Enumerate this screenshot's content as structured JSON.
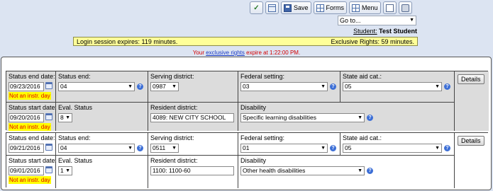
{
  "toolbar": {
    "save_label": "Save",
    "forms_label": "Forms",
    "menu_label": "Menu"
  },
  "goto": {
    "value": "Go to..."
  },
  "student": {
    "link_label": "Student:",
    "name": "Test Student"
  },
  "session": {
    "expires": "Login session expires: 119 minutes.",
    "exclusive": "Exclusive Rights: 59 minutes."
  },
  "rights": {
    "prefix": "Your ",
    "link": "exclusive rights",
    "suffix": " expire at 1:22:00 PM."
  },
  "records": [
    {
      "end_label": "Status end date:",
      "end_date": "09/23/2016",
      "end_warning": "Not an instr. day",
      "status_end_label": "Status end:",
      "status_end": "04",
      "serving_label": "Serving district:",
      "serving": "0987",
      "federal_label": "Federal setting:",
      "federal": "03",
      "stateaid_label": "State aid cat.:",
      "stateaid": "05",
      "details_label": "Details",
      "start_label": "Status start date:",
      "start_date": "09/20/2016",
      "start_warning": "Not an instr. day",
      "eval_label": "Eval. Status",
      "eval": "8",
      "resident_label": "Resident district:",
      "resident": "4089: NEW CITY SCHOOL",
      "disability_label": "Disability",
      "disability": "Specific learning disabilities"
    },
    {
      "end_label": "Status end date:",
      "end_date": "09/21/2016",
      "end_warning": "",
      "status_end_label": "Status end:",
      "status_end": "04",
      "serving_label": "Serving district:",
      "serving": "0511",
      "federal_label": "Federal setting:",
      "federal": "01",
      "stateaid_label": "State aid cat.:",
      "stateaid": "05",
      "details_label": "Details",
      "start_label": "Status start date:",
      "start_date": "09/01/2016",
      "start_warning": "Not an instr. day",
      "eval_label": "Eval. Status",
      "eval": "1",
      "resident_label": "Resident district:",
      "resident": "1100: 1100-60",
      "disability_label": "Disability",
      "disability": "Other health disabilities"
    }
  ]
}
